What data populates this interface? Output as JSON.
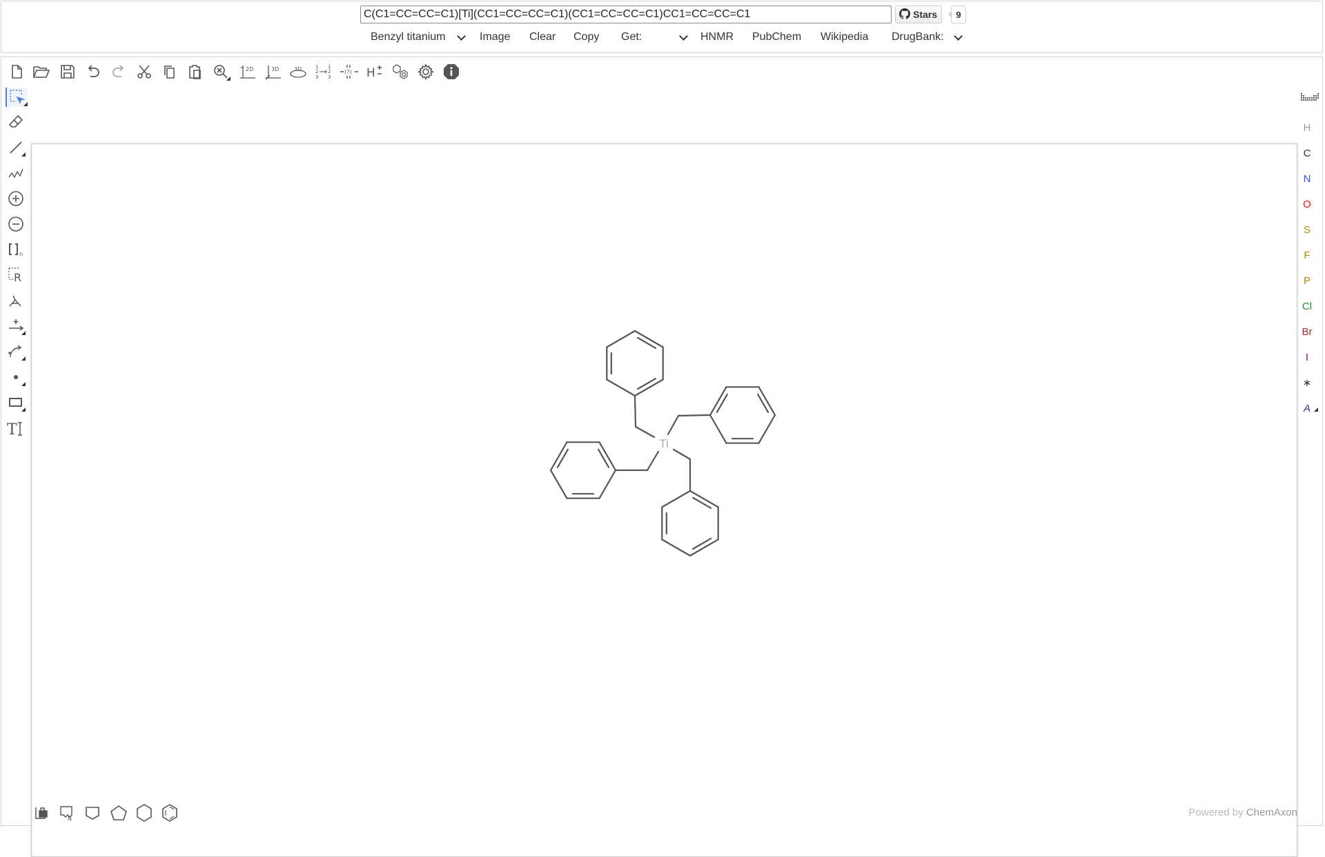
{
  "header": {
    "smiles_value": "C(C1=CC=CC=C1)[Ti](CC1=CC=CC=C1)(CC1=CC=CC=C1)CC1=CC=CC=C1",
    "github_label": "Stars",
    "github_count": "9",
    "molecule_select": "Benzyl titanium",
    "image_button": "Image",
    "clear_button": "Clear",
    "copy_button": "Copy",
    "get_select": "Get:",
    "hnmr_link": "HNMR",
    "pubchem_link": "PubChem",
    "wikipedia_link": "Wikipedia",
    "drugbank_select": "DrugBank:"
  },
  "top_toolbar": [
    "new-document",
    "open-file",
    "save",
    "undo",
    "redo",
    "cut",
    "copy",
    "paste",
    "zoom",
    "clean-2d",
    "clean-3d",
    "3d-view",
    "auto-map",
    "check-structure",
    "add-explicit-hydrogens",
    "aromatize",
    "settings",
    "about"
  ],
  "left_toolbar": [
    "select",
    "erase",
    "single-bond",
    "chain",
    "charge-plus",
    "charge-minus",
    "sgroup-bracket",
    "r-group",
    "attachment",
    "reaction-arrow",
    "curved-arrow",
    "radical",
    "rectangle-shape",
    "text"
  ],
  "right_toolbar": {
    "periodic_table": "periodic-table",
    "atoms": [
      {
        "symbol": "H",
        "color": "#999999"
      },
      {
        "symbol": "C",
        "color": "#333333"
      },
      {
        "symbol": "N",
        "color": "#3050F8"
      },
      {
        "symbol": "O",
        "color": "#FF0D0D"
      },
      {
        "symbol": "S",
        "color": "#999900"
      },
      {
        "symbol": "F",
        "color": "#B8860B"
      },
      {
        "symbol": "P",
        "color": "#B8860B"
      },
      {
        "symbol": "Cl",
        "color": "#1F8F1F"
      },
      {
        "symbol": "Br",
        "color": "#A62929"
      },
      {
        "symbol": "I",
        "color": "#940094"
      },
      {
        "symbol": "∗",
        "color": "#333333"
      },
      {
        "symbol": "A",
        "color": "#333399"
      }
    ]
  },
  "bottom_toolbar": [
    "templates",
    "amino-acids",
    "cyclopropane",
    "cyclopentane",
    "cyclohexane",
    "benzene"
  ],
  "molecule": {
    "center_atom": "Ti",
    "bond_color": "#555555"
  },
  "footer": {
    "powered_prefix": "Powered by",
    "powered_brand": "ChemAxon"
  }
}
